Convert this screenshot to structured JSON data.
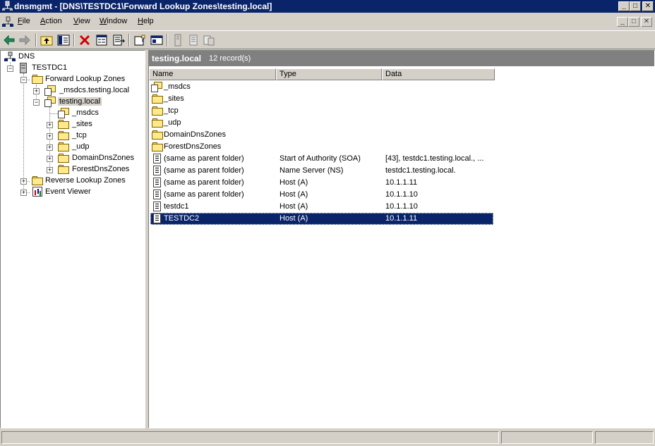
{
  "window": {
    "title": "dnsmgmt - [DNS\\TESTDC1\\Forward Lookup Zones\\testing.local]",
    "caption_buttons": {
      "minimize": "_",
      "maximize": "□",
      "close": "✕"
    }
  },
  "menubar": {
    "items": [
      {
        "label": "File",
        "accel": "F"
      },
      {
        "label": "Action",
        "accel": "A"
      },
      {
        "label": "View",
        "accel": "V"
      },
      {
        "label": "Window",
        "accel": "W"
      },
      {
        "label": "Help",
        "accel": "H"
      }
    ],
    "mdi_buttons": {
      "minimize": "_",
      "restore": "□",
      "close": "✕"
    }
  },
  "toolbar": {
    "buttons": [
      "back-icon",
      "forward-icon",
      "up-one-level-icon",
      "show-hide-tree-icon",
      "delete-icon",
      "properties-icon",
      "export-list-icon",
      "help-icon",
      "new-window-icon",
      "new-host-icon",
      "new-alias-icon",
      "new-mail-exchanger-icon"
    ]
  },
  "tree": {
    "root": "DNS",
    "server": "TESTDC1",
    "forward_zones": "Forward Lookup Zones",
    "msdcs_zone": "_msdcs.testing.local",
    "testing_zone": "testing.local",
    "msdcs_child": "_msdcs",
    "sites": "_sites",
    "tcp": "_tcp",
    "udp": "_udp",
    "domain_dns_zones": "DomainDnsZones",
    "forest_dns_zones": "ForestDnsZones",
    "reverse_zones": "Reverse Lookup Zones",
    "event_viewer": "Event Viewer",
    "expander_plus": "+",
    "expander_minus": "−"
  },
  "detail": {
    "title": "testing.local",
    "record_count": "12 record(s)",
    "columns": {
      "name": "Name",
      "type": "Type",
      "data": "Data"
    },
    "rows": [
      {
        "name": "_msdcs",
        "type": "",
        "data": "",
        "icon": "zone"
      },
      {
        "name": "_sites",
        "type": "",
        "data": "",
        "icon": "folder"
      },
      {
        "name": "_tcp",
        "type": "",
        "data": "",
        "icon": "folder"
      },
      {
        "name": "_udp",
        "type": "",
        "data": "",
        "icon": "folder"
      },
      {
        "name": "DomainDnsZones",
        "type": "",
        "data": "",
        "icon": "folder"
      },
      {
        "name": "ForestDnsZones",
        "type": "",
        "data": "",
        "icon": "folder"
      },
      {
        "name": "(same as parent folder)",
        "type": "Start of Authority (SOA)",
        "data": "[43], testdc1.testing.local., ...",
        "icon": "record"
      },
      {
        "name": "(same as parent folder)",
        "type": "Name Server (NS)",
        "data": "testdc1.testing.local.",
        "icon": "record"
      },
      {
        "name": "(same as parent folder)",
        "type": "Host (A)",
        "data": "10.1.1.11",
        "icon": "record"
      },
      {
        "name": "(same as parent folder)",
        "type": "Host (A)",
        "data": "10.1.1.10",
        "icon": "record"
      },
      {
        "name": "testdc1",
        "type": "Host (A)",
        "data": "10.1.1.10",
        "icon": "record"
      },
      {
        "name": "TESTDC2",
        "type": "Host (A)",
        "data": "10.1.1.11",
        "icon": "record",
        "selected": true
      }
    ]
  },
  "colors": {
    "title_bar": "#0a246a",
    "selection": "#0a246a",
    "chrome": "#d4d0c8",
    "pane_header": "#808080"
  }
}
